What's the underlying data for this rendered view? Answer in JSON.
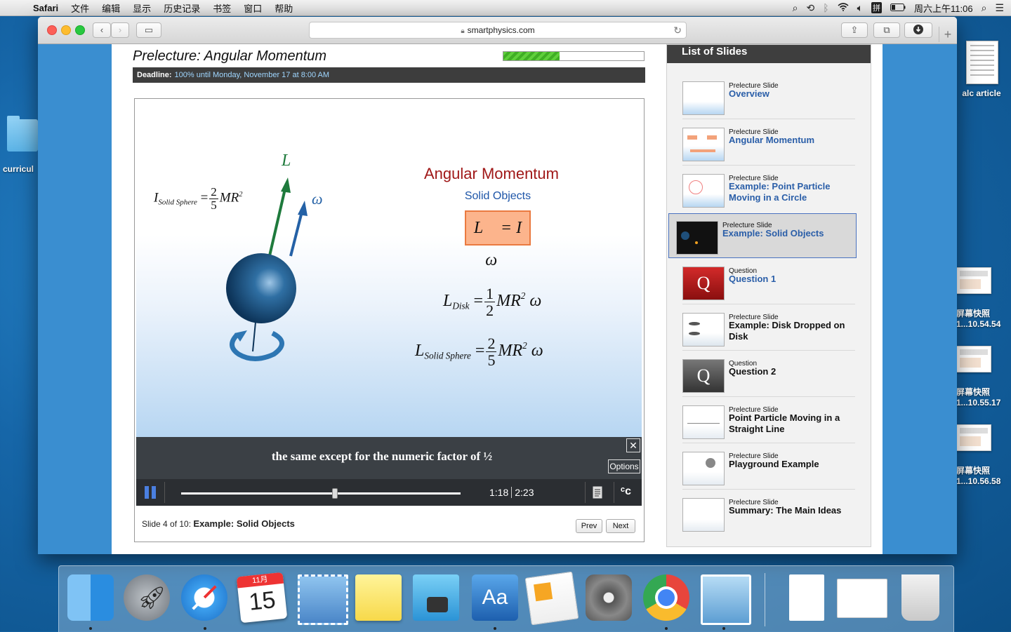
{
  "menubar": {
    "apple": "",
    "app": "Safari",
    "items": [
      "文件",
      "编辑",
      "显示",
      "历史记录",
      "书签",
      "窗口",
      "帮助"
    ],
    "clock": "周六上午11:06"
  },
  "desktop": {
    "folder_label": "curricul",
    "doc_label": "alc article",
    "screenshots": [
      {
        "line1": "屏幕快照",
        "line2": "1...10.54.54"
      },
      {
        "line1": "屏幕快照",
        "line2": "1...10.55.17"
      },
      {
        "line1": "屏幕快照",
        "line2": "1...10.56.58"
      }
    ]
  },
  "browser": {
    "url": "smartphysics.com"
  },
  "lecture": {
    "title": "Prelecture: Angular Momentum",
    "progress_fraction": 0.4,
    "deadline_label": "Deadline:",
    "deadline_value": "100% until Monday, November 17 at 8:00 AM"
  },
  "slide": {
    "title": "Angular Momentum",
    "subtitle": "Solid Objects",
    "boxed_eq": "L⃗ = I ω⃗",
    "L_vec": "L⃗",
    "omega_vec": "ω⃗",
    "inertia_lhs": "I",
    "inertia_sub": "Solid Sphere",
    "disk_lhs": "L",
    "disk_sub": "Disk",
    "sphere_lhs": "L",
    "sphere_sub": "Solid Sphere",
    "frac_half_n": "1",
    "frac_half_d": "2",
    "frac_25_n": "2",
    "frac_25_d": "5",
    "mr2": "MR",
    "sq": "2",
    "omega": "ω",
    "equals": "="
  },
  "player": {
    "caption": "the same except for the numeric factor of ½",
    "options_label": "Options",
    "close_label": "✕",
    "time_current": "1:18",
    "time_total": "2:23",
    "seek_fraction": 0.55,
    "cc_label": "CC"
  },
  "slide_info": {
    "prefix": "Slide 4 of 10:",
    "name": "Example: Solid Objects",
    "prev": "Prev",
    "next": "Next"
  },
  "sidebar": {
    "title": "List of Slides",
    "items": [
      {
        "kind": "Prelecture Slide",
        "name": "Overview"
      },
      {
        "kind": "Prelecture Slide",
        "name": "Angular Momentum"
      },
      {
        "kind": "Prelecture Slide",
        "name": "Example: Point Particle Moving in a Circle"
      },
      {
        "kind": "Prelecture Slide",
        "name": "Example: Solid Objects"
      },
      {
        "kind": "Question",
        "name": "Question 1"
      },
      {
        "kind": "Prelecture Slide",
        "name": "Example: Disk Dropped on Disk"
      },
      {
        "kind": "Question",
        "name": "Question 2"
      },
      {
        "kind": "Prelecture Slide",
        "name": "Point Particle Moving in a Straight Line"
      },
      {
        "kind": "Prelecture Slide",
        "name": "Playground Example"
      },
      {
        "kind": "Prelecture Slide",
        "name": "Summary: The Main Ideas"
      }
    ]
  },
  "dock": {
    "apps": [
      "finder-icon",
      "launchpad-icon",
      "safari-icon",
      "calendar-icon",
      "mail-icon",
      "notes-icon",
      "image-capture-icon",
      "dictionary-icon",
      "pages-icon",
      "system-preferences-icon",
      "chrome-icon",
      "preview-icon",
      "document-icon",
      "screenshot-icon",
      "trash-icon"
    ],
    "calendar_month": "11月",
    "calendar_day": "15"
  }
}
